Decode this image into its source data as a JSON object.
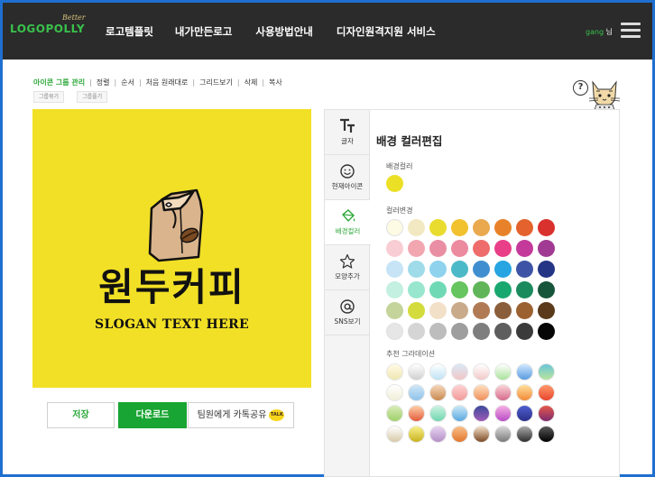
{
  "header": {
    "logo_small": "Better",
    "logo_main": "LOGOPOLLY",
    "nav": [
      "로고템플릿",
      "내가만든로고",
      "사용방법안내",
      "디자인원격지원 서비스"
    ],
    "user_name": "gang",
    "user_suffix": " 님"
  },
  "toolbar": {
    "items": [
      "아이콘 그룹 관리",
      "정렬",
      "순서",
      "처음 원래대로",
      "그리드보기",
      "삭제",
      "복사"
    ],
    "group_buttons": [
      "그룹묶기",
      "그룹풀기"
    ],
    "help_label": "?"
  },
  "canvas": {
    "background": "#f2e026",
    "headline": "원두커피",
    "slogan": "SLOGAN TEXT HERE",
    "icon": "coffee-bag-icon"
  },
  "actions": {
    "save": "저장",
    "download": "다운로드",
    "share": "팀원에게 카톡공유",
    "talk_badge": "TALK"
  },
  "tabs": [
    {
      "label": "글자",
      "icon": "text-icon"
    },
    {
      "label": "현재아이콘",
      "icon": "smiley-icon"
    },
    {
      "label": "배경컬러",
      "icon": "paint-bucket-icon"
    },
    {
      "label": "모양추가",
      "icon": "star-icon"
    },
    {
      "label": "SNS보기",
      "icon": "at-sign-icon"
    }
  ],
  "panel": {
    "title": "배경 컬러편집",
    "bg_color_label": "배경컬러",
    "current_color": "#ece027",
    "color_change_label": "컬러변경",
    "gradient_label": "추천 그라데이션",
    "colors": [
      [
        "#fdfbe3",
        "#f2e9c2",
        "#eadc2e",
        "#f2c12e",
        "#eaa94e",
        "#e8822a",
        "#e4622d",
        "#d9312e"
      ],
      [
        "#f8cdd3",
        "#f2a7b0",
        "#ea8fa3",
        "#ec8aa0",
        "#ee6c6c",
        "#e83f88",
        "#c43a9a",
        "#a13a92"
      ],
      [
        "#c6e4f6",
        "#9fdbe8",
        "#8fd2ee",
        "#4cb9c8",
        "#3f8fd0",
        "#27a4e2",
        "#3d54a6",
        "#243585"
      ],
      [
        "#c3f0e0",
        "#98e6ce",
        "#6fd9b5",
        "#66c55e",
        "#5fb557",
        "#18a86f",
        "#1b8a5c",
        "#17553a"
      ],
      [
        "#c4d49a",
        "#d3dc3c",
        "#f3e0c8",
        "#c9ab8c",
        "#b07b54",
        "#8b5e3b",
        "#9b6130",
        "#5a3a1a"
      ],
      [
        "#e6e6e6",
        "#d5d5d5",
        "#bdbdbd",
        "#9e9e9e",
        "#7e7e7e",
        "#5e5e5e",
        "#3b3b3b",
        "#070707"
      ]
    ],
    "gradients": [
      [
        [
          "#fffbe6",
          "#efe6b0"
        ],
        [
          "#ffffff",
          "#cfcfcf"
        ],
        [
          "#ffffff",
          "#bfe3f5"
        ],
        [
          "#d9e9f7",
          "#f2c6c6"
        ],
        [
          "#ffffff",
          "#f3c8c8"
        ],
        [
          "#ffffff",
          "#a8e29a"
        ],
        [
          "#cfe8ff",
          "#5a9be0"
        ],
        [
          "#6ac6d8",
          "#b9e49c"
        ]
      ],
      [
        [
          "#ffffff",
          "#efefd8"
        ],
        [
          "#cfe6f8",
          "#8fc3ea"
        ],
        [
          "#f7d6b8",
          "#c98a52"
        ],
        [
          "#ffd2d2",
          "#f29a9a"
        ],
        [
          "#ffe0c0",
          "#ef8f5a"
        ],
        [
          "#fbd3d7",
          "#d56b8d"
        ],
        [
          "#ffe09a",
          "#f38a3a"
        ],
        [
          "#ff9a6a",
          "#e8452e"
        ]
      ],
      [
        [
          "#d8ecb8",
          "#9fcf6a"
        ],
        [
          "#ffd0a8",
          "#e45b3c"
        ],
        [
          "#cdf3e2",
          "#6fd6b0"
        ],
        [
          "#cbe8f7",
          "#5aa9e0"
        ],
        [
          "#3b4a9c",
          "#a05ab7"
        ],
        [
          "#f7b0e3",
          "#b84cc7"
        ],
        [
          "#4f5fd0",
          "#2b2f8a"
        ],
        [
          "#e5584a",
          "#7d2a6f"
        ]
      ],
      [
        [
          "#ffffff",
          "#d7c9a8"
        ],
        [
          "#f8f08a",
          "#c9b21f"
        ],
        [
          "#e8d5f2",
          "#b48fc7"
        ],
        [
          "#f9c08a",
          "#e2772e"
        ],
        [
          "#f3e0c8",
          "#7b4a26"
        ],
        [
          "#d9d9d9",
          "#7a7a7a"
        ],
        [
          "#a9a9a9",
          "#2e2e2e"
        ],
        [
          "#5a5a5a",
          "#000000"
        ]
      ]
    ]
  }
}
